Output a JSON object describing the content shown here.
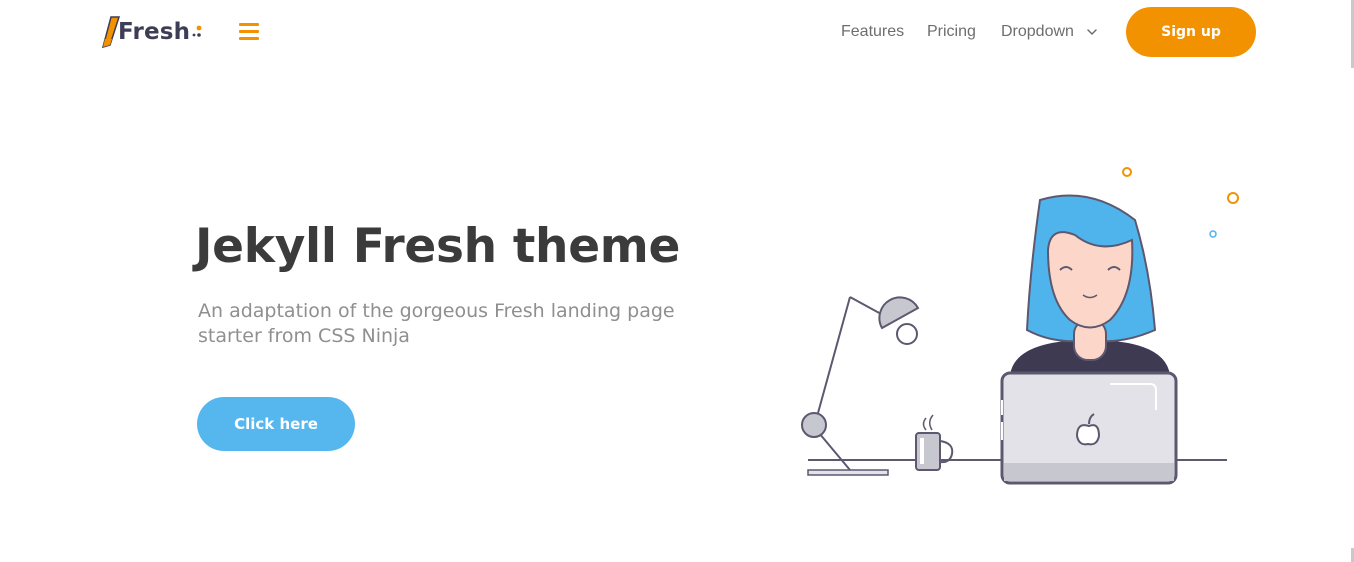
{
  "navbar": {
    "logo_text": "Fresh",
    "links": [
      {
        "label": "Features"
      },
      {
        "label": "Pricing"
      },
      {
        "label": "Dropdown"
      }
    ],
    "signup_label": "Sign up"
  },
  "hero": {
    "title": "Jekyll Fresh theme",
    "subtitle": "An adaptation of the gorgeous Fresh landing page starter from CSS Ninja",
    "cta_label": "Click here"
  },
  "colors": {
    "accent": "#f39200",
    "primary": "#56b6ee",
    "title_text": "#3b3b3b",
    "subtitle_text": "#8f8f8f",
    "nav_text": "#6e6e6e"
  },
  "icons": {
    "menu": "hamburger-icon",
    "dropdown": "chevron-down-icon",
    "logo": "fresh-logo-icon"
  }
}
